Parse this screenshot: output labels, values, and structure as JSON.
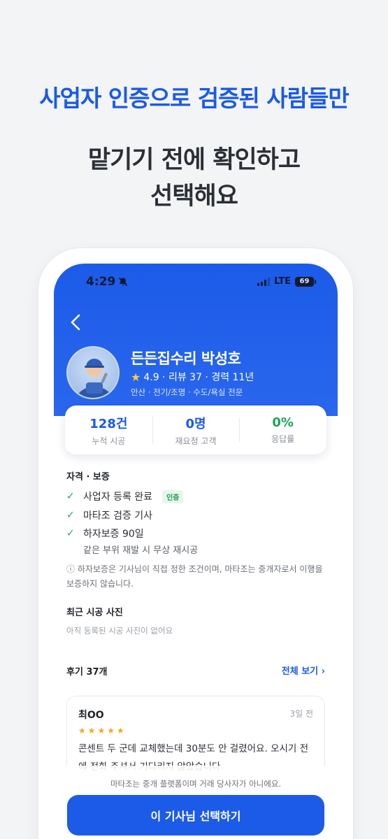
{
  "promo": {
    "headline": "사업자 인증으로 검증된 사람들만",
    "sub_line1": "맡기기 전에 확인하고",
    "sub_line2": "선택해요"
  },
  "status_bar": {
    "time": "4:29",
    "network": "LTE",
    "battery": "69"
  },
  "profile": {
    "name": "든든집수리 박성호",
    "rating": "4.9",
    "meta": "4.9 · 리뷰 37 · 경력 11년",
    "specialty": "안산 · 전기/조명 · 수도/욕실 전문"
  },
  "stats": [
    {
      "value": "128건",
      "label": "누적 시공"
    },
    {
      "value": "0명",
      "label": "재요청 고객"
    },
    {
      "value": "0%",
      "label": "응답률"
    }
  ],
  "qualifications": {
    "title": "자격 · 보증",
    "items": [
      {
        "label": "사업자 등록 완료",
        "badge": "인증"
      },
      {
        "label": "마타조 검증 기사"
      },
      {
        "label": "하자보증 90일",
        "note": "같은 부위 재발 시 무상 재시공"
      }
    ],
    "disclaimer": "ⓘ 하자보증은 기사님이 직접 정한 조건이며, 마타조는 중개자로서 이행을 보증하지 않습니다."
  },
  "photos": {
    "title": "최근 시공 사진",
    "empty": "아직 등록된 시공 사진이 없어요"
  },
  "reviews": {
    "title": "후기 37개",
    "view_all": "전체 보기 ›",
    "item": {
      "name": "최OO",
      "date": "3일 전",
      "stars": "★★★★★",
      "text": "콘센트 두 군데 교체했는데 30분도 안 걸렸어요. 오시기 전에 전화 주셔서 기다리지 않았습니다."
    }
  },
  "footer": {
    "note": "마타조는 중개 플랫폼이며 거래 당사자가 아니에요.",
    "cta": "이 기사님 선택하기"
  },
  "colors": {
    "brand_blue": "#1c5be8",
    "check_green": "#2aa55a",
    "star_orange": "#f5a623"
  }
}
